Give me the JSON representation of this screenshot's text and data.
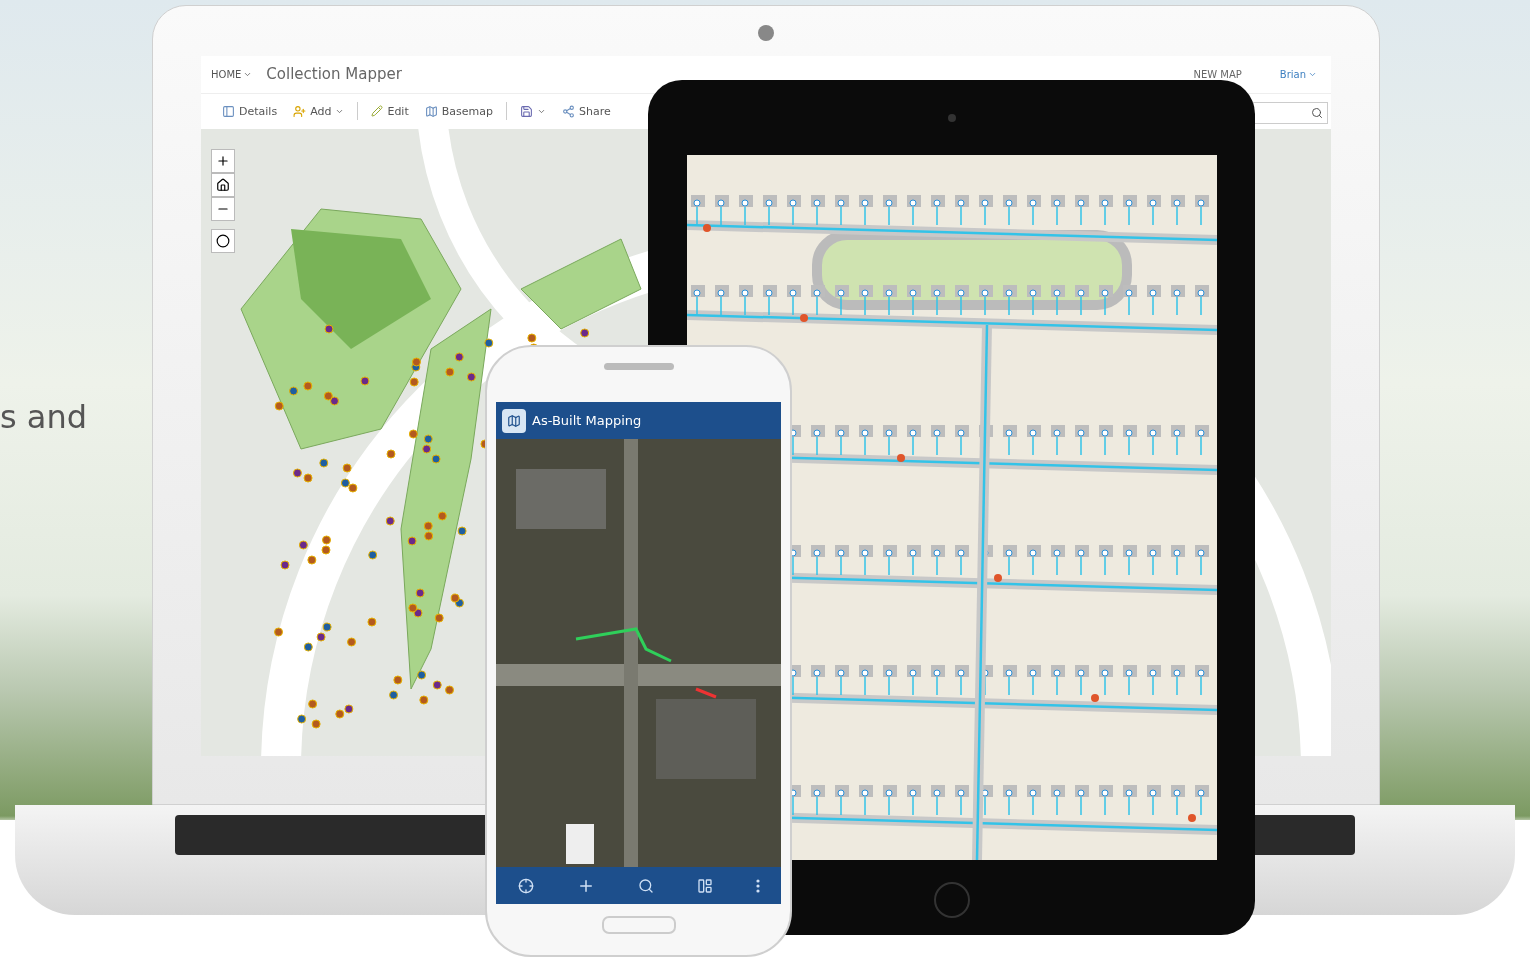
{
  "hero_text": "s and",
  "laptop": {
    "app_bar": {
      "home": "HOME",
      "title": "Collection Mapper",
      "new_map": "NEW MAP",
      "user": "Brian"
    },
    "toolbar": [
      {
        "kind": "button",
        "label": "Details"
      },
      {
        "kind": "dropdown",
        "label": "Add"
      },
      {
        "kind": "divider"
      },
      {
        "kind": "button",
        "label": "Edit"
      },
      {
        "kind": "button",
        "label": "Basemap"
      },
      {
        "kind": "divider"
      },
      {
        "kind": "icon-dropdown"
      },
      {
        "kind": "button",
        "label": "Share"
      }
    ]
  },
  "phone": {
    "app_title": "As-Built Mapping"
  }
}
